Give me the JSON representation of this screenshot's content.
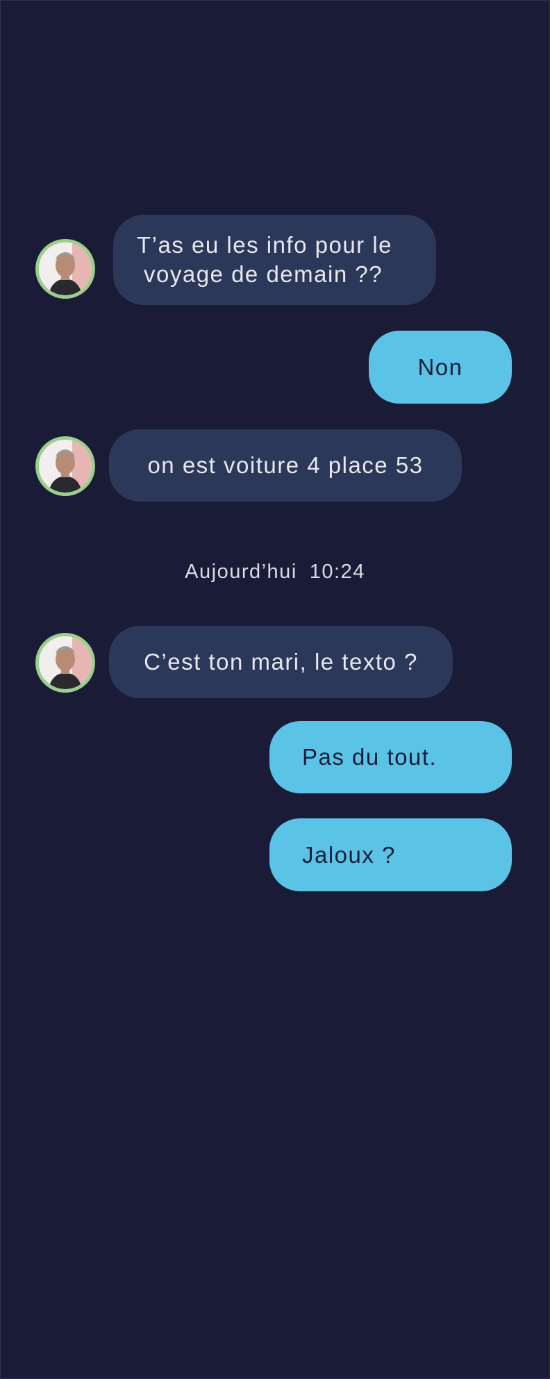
{
  "conversation": {
    "messages": [
      {
        "direction": "incoming",
        "text_line1": "T’as eu les info pour le",
        "text_line2": "voyage de demain ??"
      },
      {
        "direction": "outgoing",
        "text": "Non"
      },
      {
        "direction": "incoming",
        "text": "on est voiture 4 place 53"
      },
      {
        "direction": "incoming",
        "text": "C’est ton mari, le texto ?"
      },
      {
        "direction": "outgoing",
        "text": "Pas du tout."
      },
      {
        "direction": "outgoing",
        "text": "Jaloux ?"
      }
    ],
    "timestamp": {
      "day": "Aujourd’hui",
      "time": "10:24"
    }
  },
  "colors": {
    "background": "#1a1b37",
    "incoming_bubble": "#2c3859",
    "outgoing_bubble": "#5bc3e6",
    "avatar_ring": "#9ccf8d"
  },
  "icons": {
    "avatar": "contact-avatar-photo"
  }
}
